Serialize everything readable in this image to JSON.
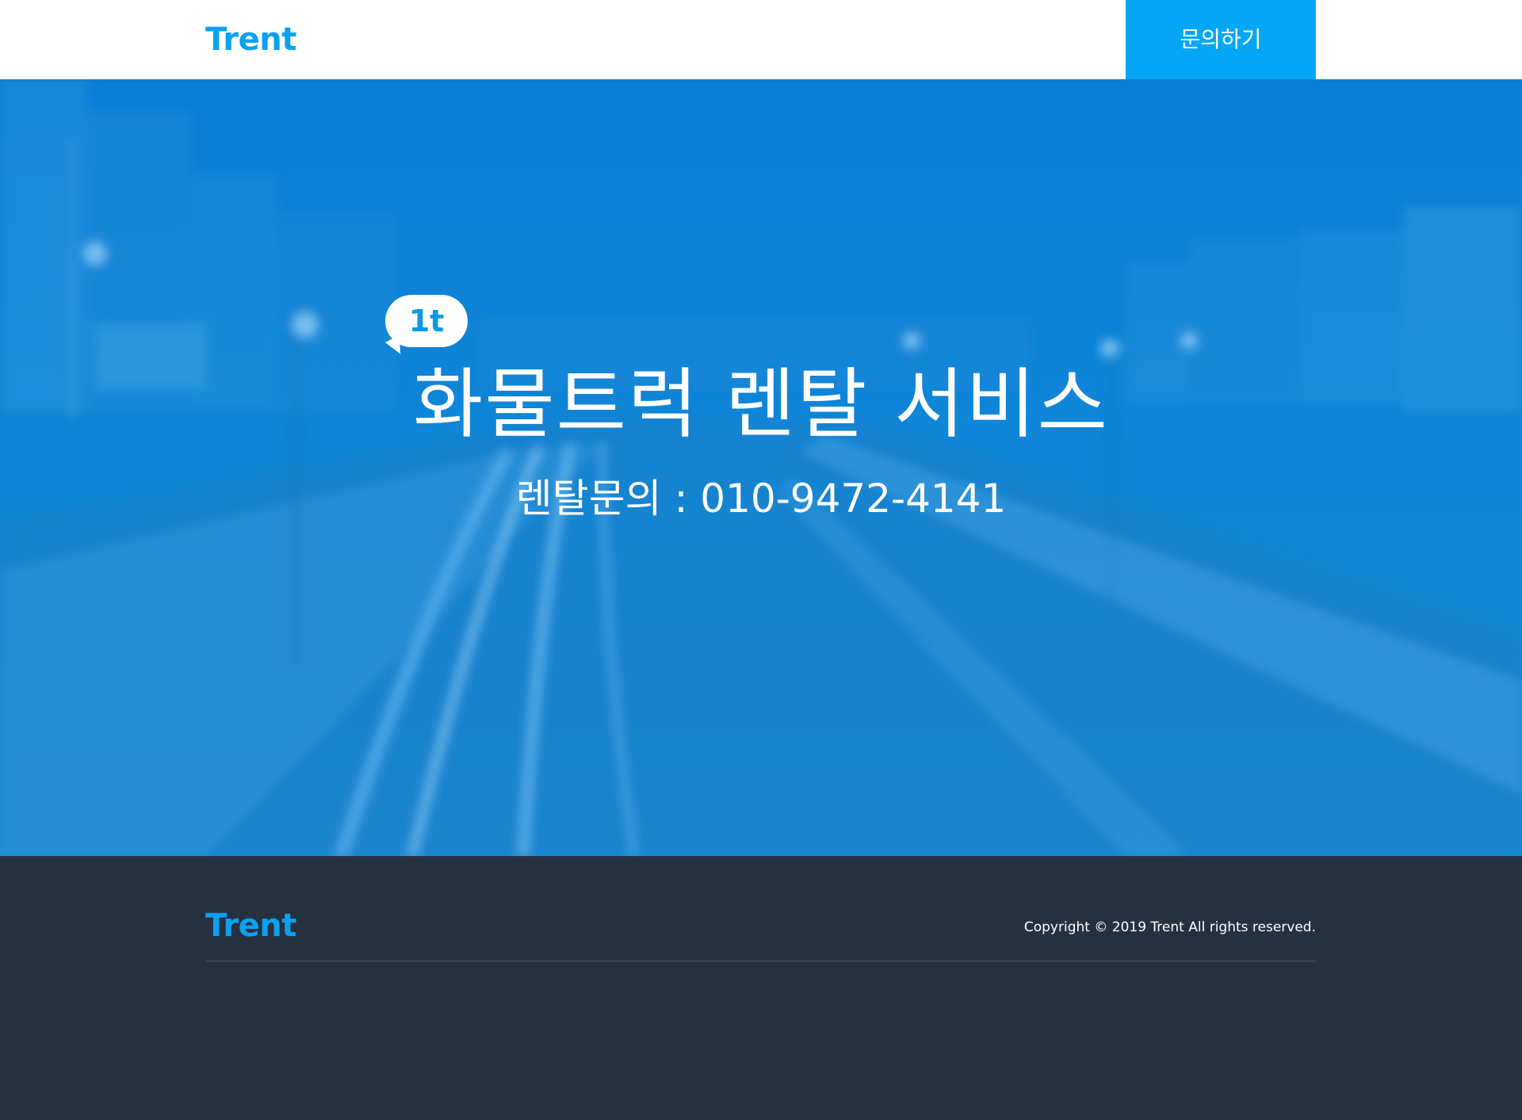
{
  "header": {
    "logo": "Trent",
    "contact_button": "문의하기"
  },
  "hero": {
    "badge": "1t",
    "title": "화물트럭 렌탈 서비스",
    "subtitle": "렌탈문의 : 010-9472-4141"
  },
  "footer": {
    "logo": "Trent",
    "copyright": "Copyright © 2019 Trent All rights reserved."
  },
  "colors": {
    "brand": "#0aa2f0",
    "button": "#04a7f6",
    "footer_bg": "#263140"
  }
}
